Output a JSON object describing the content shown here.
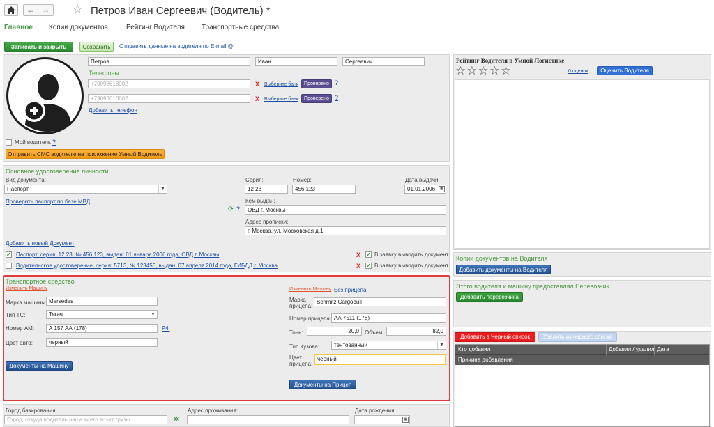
{
  "header": {
    "title": "Петров Иван Сергеевич (Водитель) *"
  },
  "tabs": [
    "Главное",
    "Копии документов",
    "Рейтинг Водителя",
    "Транспортные средства"
  ],
  "toolbar": {
    "save_close": "Записать и закрыть",
    "save": "Сохранить",
    "send_email": "Отправить данные на водителя по E-mail @"
  },
  "driver": {
    "last_name": "Петров",
    "first_name": "Иван",
    "middle_name": "Сергеевич",
    "phones_title": "Телефоны",
    "phones": [
      {
        "number": "+79093618002",
        "bank_link": "Выберите банк",
        "verified": "Проверено"
      },
      {
        "number": "+79093618002",
        "bank_link": "Выберите банк",
        "verified": "Проверено"
      }
    ],
    "add_phone": "Добавить телефон",
    "my_driver": "Мой водитель",
    "sms_button": "Отправить СМС водителю на приложение Умный Водитель"
  },
  "identity": {
    "title": "Основное удостоверение личности",
    "doc_type_label": "Вид документа:",
    "doc_type": "Паспорт",
    "series_label": "Серия:",
    "series": "12 23",
    "number_label": "Номер:",
    "number": "456 123",
    "issue_date_label": "Дата выдачи:",
    "issue_date": "01.01.2006",
    "check_link": "Проверить паспорт по базе МВД",
    "issued_by_label": "Кем выдан:",
    "issued_by": "ОВД г. Москвы",
    "address_label": "Адрес прописки:",
    "address": "г. Москва, ул. Московская д.1",
    "add_doc": "Добавить новый Документ",
    "documents": [
      {
        "text": "Паспорт, серия: 12 23, № 456 123, выдан: 01 января 2006 года, ОВД г. Москвы",
        "checked": true,
        "show": "В заявку выводить документ"
      },
      {
        "text": "Водительское удостоверение, серия: 5713, № 123456, выдан: 07 апреля 2014 года, ГИБДД г. Москва",
        "checked": false,
        "show": "В заявку выводить документ"
      }
    ]
  },
  "vehicle": {
    "title": "Транспортное средство",
    "change_car": "Изменить Машину",
    "brand_label": "Марка машины:",
    "brand": "Mersedes",
    "type_label": "Тип ТС:",
    "type": "Тягач",
    "plate_label": "Номер АМ:",
    "plate": "А 157 АА (178)",
    "rf": "РФ",
    "color_label": "Цвет авто:",
    "color": "черный",
    "docs_button": "Документы на Машину",
    "change_trailer": "Изменить Машину",
    "no_trailer": "Без прицепа",
    "trailer_brand_label1": "Марка",
    "trailer_brand_label2": "прицепа:",
    "trailer_brand": "Schmitz Cargobull",
    "trailer_number_label": "Номер прицепа:",
    "trailer_number": "АА 7511 (178)",
    "tons_label": "Тонн:",
    "tons": "20,0",
    "volume_label": "Объем:",
    "volume": "82,0",
    "body_type_label": "Тип Кузова:",
    "body_type": "тентованный",
    "trailer_color_label1": "Цвет",
    "trailer_color_label2": "прицепа:",
    "trailer_color": "черный",
    "trailer_docs_button": "Документы на Прицеп"
  },
  "bottom": {
    "city_label": "Город базирования:",
    "city_placeholder": "Город, откуда водитель чаще всего возит грузы",
    "residence_label": "Адрес проживания:",
    "birth_label": "Дата рождения:",
    "birth_value": ". ."
  },
  "rating": {
    "title": "Рейтинг Водителя в Умной Логистике",
    "reviews_link": "0 оценок",
    "rate_button": "Оценить Водителя"
  },
  "copies": {
    "title": "Копии документов на Водителя",
    "add_button": "Добавить документы на Водителя"
  },
  "carrier": {
    "title": "Этого водителя и машину предоставлял Перевозчик",
    "add_button": "Добавить перевозчика"
  },
  "blacklist": {
    "add_button": "Добавить в Черный список",
    "remove_button": "Удалить из черного списка",
    "columns": [
      "Кто добавил",
      "Добавил / удалил",
      "Дата"
    ],
    "reason_header": "Причина добавления"
  },
  "colors": {
    "accent_green": "#4a9a3e",
    "link_blue": "#1b4fa3",
    "highlight_red": "#e23b3b"
  }
}
